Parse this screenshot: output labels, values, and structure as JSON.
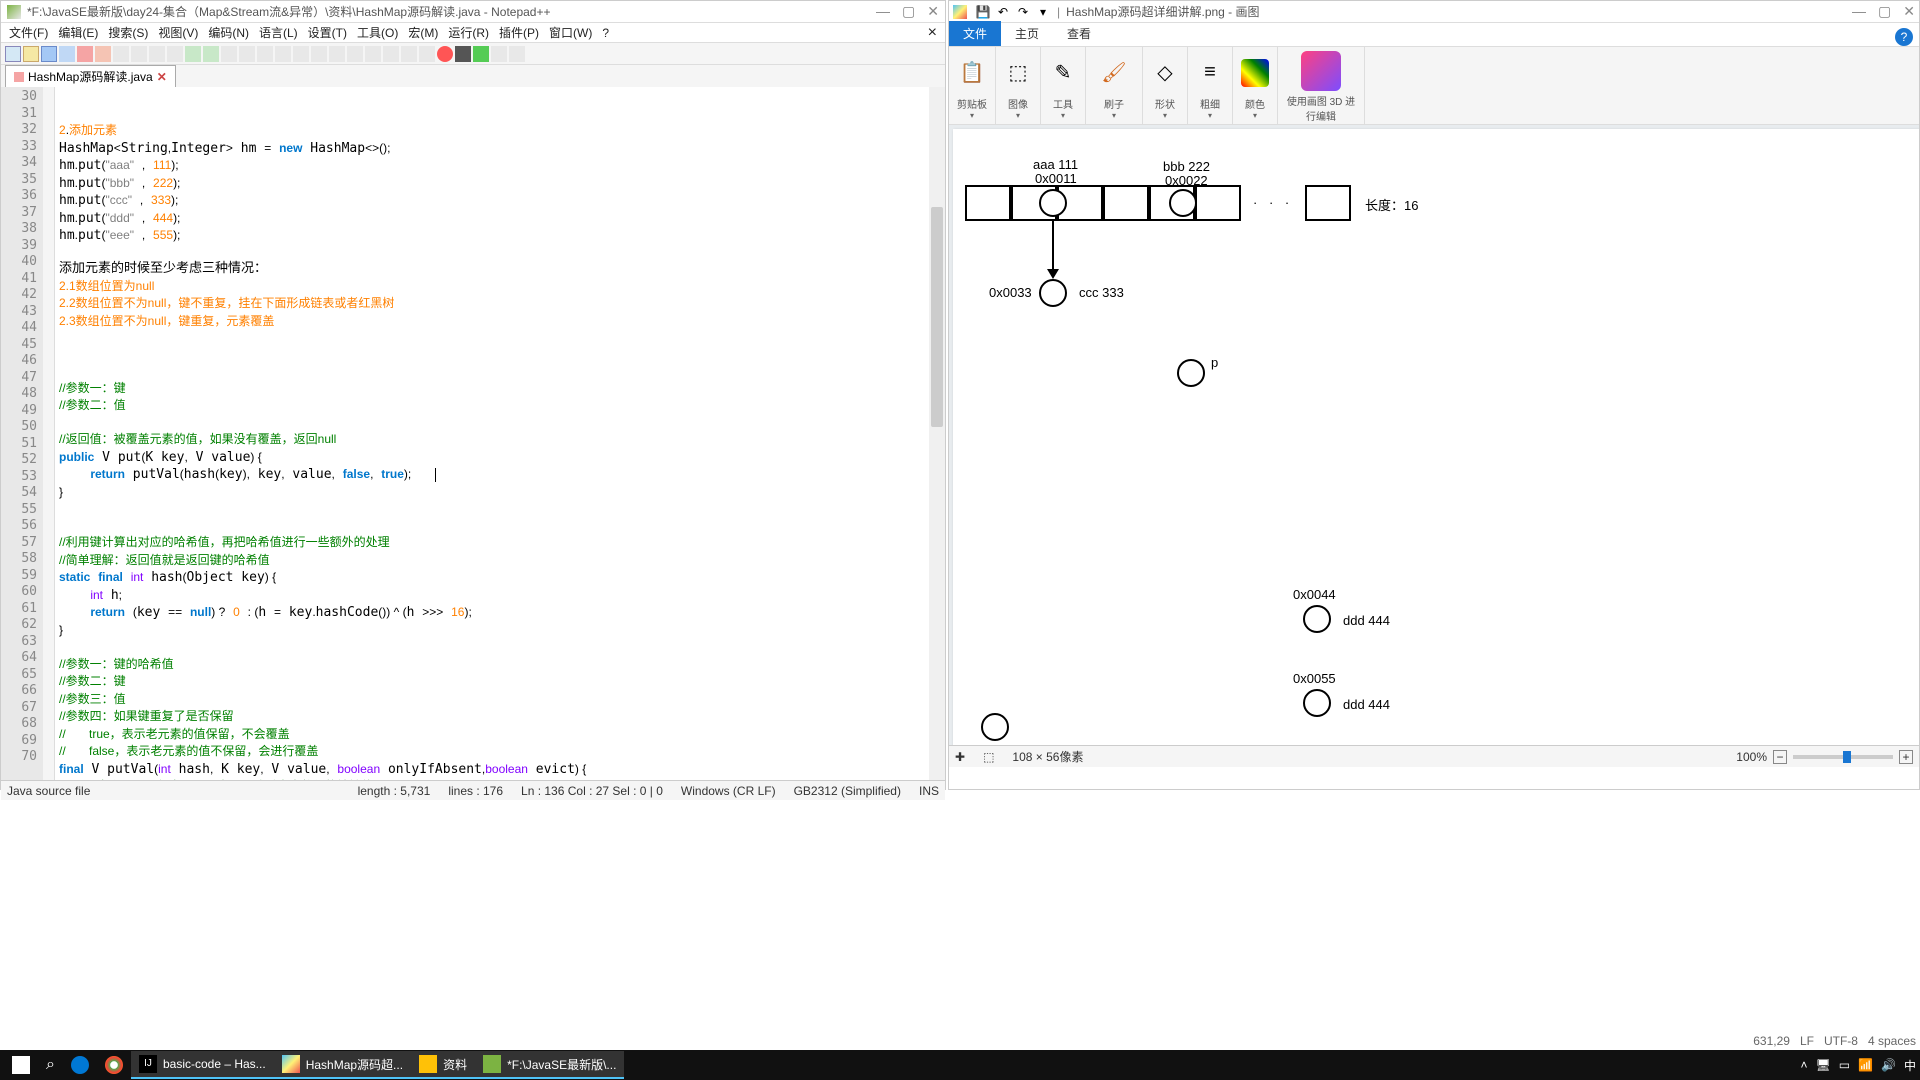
{
  "npp": {
    "title": "*F:\\JavaSE最新版\\day24-集合（Map&Stream流&异常）\\资料\\HashMap源码解读.java - Notepad++",
    "menu": [
      "文件(F)",
      "编辑(E)",
      "搜索(S)",
      "视图(V)",
      "编码(N)",
      "语言(L)",
      "设置(T)",
      "工具(O)",
      "宏(M)",
      "运行(R)",
      "插件(P)",
      "窗口(W)",
      "?"
    ],
    "tab": {
      "name": "HashMap源码解读.java",
      "close": "✕"
    },
    "lines_start": 30,
    "lines_end": 70,
    "status": {
      "lang": "Java source file",
      "length": "length : 5,731",
      "lines": "lines : 176",
      "pos": "Ln : 136   Col : 27   Sel : 0 | 0",
      "eol": "Windows (CR LF)",
      "enc": "GB2312 (Simplified)",
      "mode": "INS"
    }
  },
  "paint": {
    "title": "HashMap源码超详细讲解.png - 画图",
    "qat_sep": "|",
    "tabs": {
      "file": "文件",
      "home": "主页",
      "view": "查看"
    },
    "ribbon": {
      "clipboard": "剪贴板",
      "image": "图像",
      "tools": "工具",
      "brushes": "刷子",
      "shapes": "形状",
      "size": "粗细",
      "colors": "颜色",
      "paint3d": "使用画图 3D 进行编辑"
    },
    "status": {
      "coords": "631,29",
      "dims": "108 × 56像素",
      "zoom": "100%",
      "unit": "LF",
      "enc": "UTF-8",
      "spaces": "4 spaces"
    },
    "diagram": {
      "aaa_label": "aaa  111",
      "aaa_addr": "0x0011",
      "bbb_label": "bbb 222",
      "bbb_addr": "0x0022",
      "ccc_addr": "0x0033",
      "ccc_label": "ccc 333",
      "len_label": "长度：16",
      "p_label": "p",
      "ddd_addr": "0x0044",
      "ddd_label": "ddd 444",
      "eee_addr": "0x0055",
      "eee_label": "ddd 444",
      "dots": "· · ·"
    }
  },
  "taskbar": {
    "items": [
      {
        "icon": "idea",
        "label": "basic-code – Has..."
      },
      {
        "icon": "paint",
        "label": "HashMap源码超..."
      },
      {
        "icon": "folder",
        "label": "资料"
      },
      {
        "icon": "npp",
        "label": "*F:\\JavaSE最新版\\..."
      }
    ],
    "lang": "中"
  }
}
